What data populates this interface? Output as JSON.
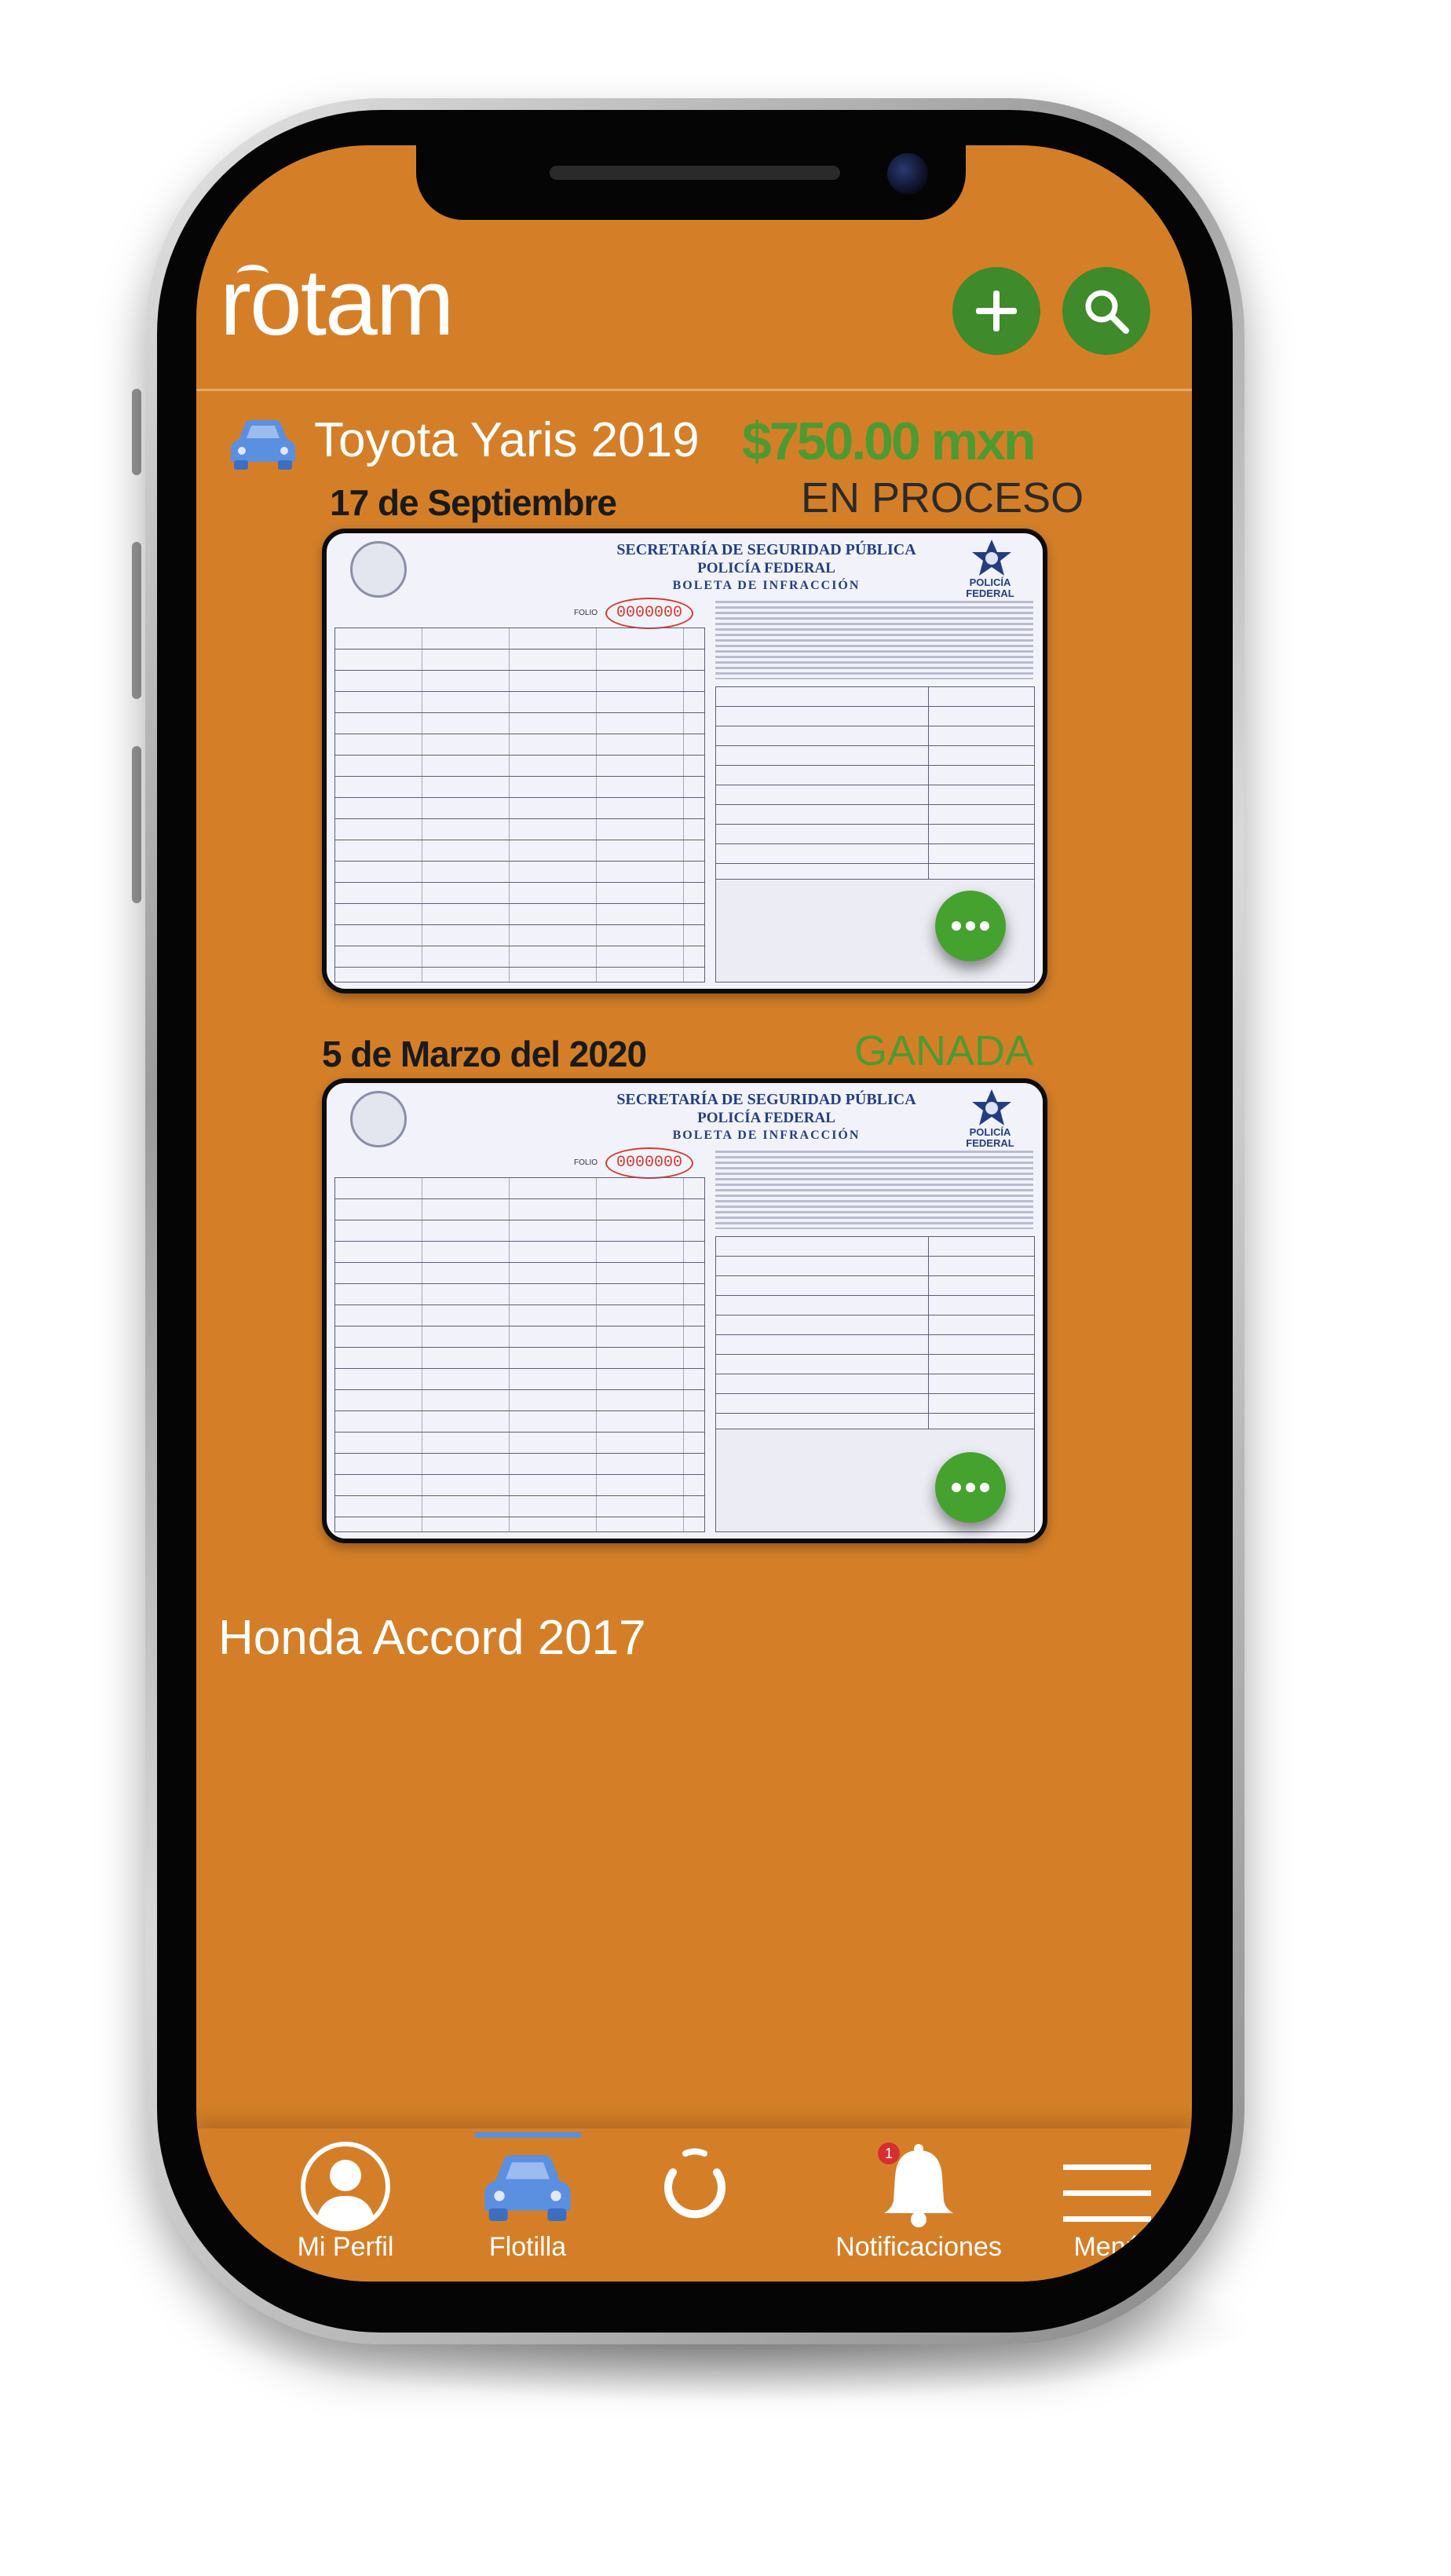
{
  "app": {
    "logo_text": "rotam"
  },
  "header": {
    "add_button": "+",
    "search_button": "search"
  },
  "vehicles": [
    {
      "name": "Toyota Yaris 2019",
      "amount": "$750.00 mxn",
      "tickets": [
        {
          "date": "17 de Septiembre",
          "status": "EN PROCESO",
          "status_color": "#2a2a2a",
          "doc_title1": "SECRETARÍA DE SEGURIDAD PÚBLICA",
          "doc_title2": "POLICÍA FEDERAL",
          "doc_title3": "BOLETA DE INFRACCIÓN",
          "folio_label": "FOLIO",
          "folio": "0000000",
          "badge_text": "POLICÍA FEDERAL"
        },
        {
          "date": "5 de Marzo del 2020",
          "status": "GANADA",
          "status_color": "#4E9A32",
          "doc_title1": "SECRETARÍA DE SEGURIDAD PÚBLICA",
          "doc_title2": "POLICÍA FEDERAL",
          "doc_title3": "BOLETA DE INFRACCIÓN",
          "folio_label": "FOLIO",
          "folio": "0000000",
          "badge_text": "POLICÍA FEDERAL"
        }
      ]
    },
    {
      "name": "Honda Accord 2017"
    }
  ],
  "nav": {
    "items": [
      {
        "label": "Mi Perfil",
        "icon": "user-icon"
      },
      {
        "label": "Flotilla",
        "icon": "car-icon",
        "active": true
      },
      {
        "label": "",
        "icon": "rotam-logo-icon"
      },
      {
        "label": "Notificaciones",
        "icon": "bell-icon",
        "badge": "1"
      },
      {
        "label": "Menú",
        "icon": "hamburger-icon"
      }
    ]
  },
  "colors": {
    "background": "#D47F28",
    "green": "#46A22E",
    "accent_blue": "#5B8FE0"
  }
}
